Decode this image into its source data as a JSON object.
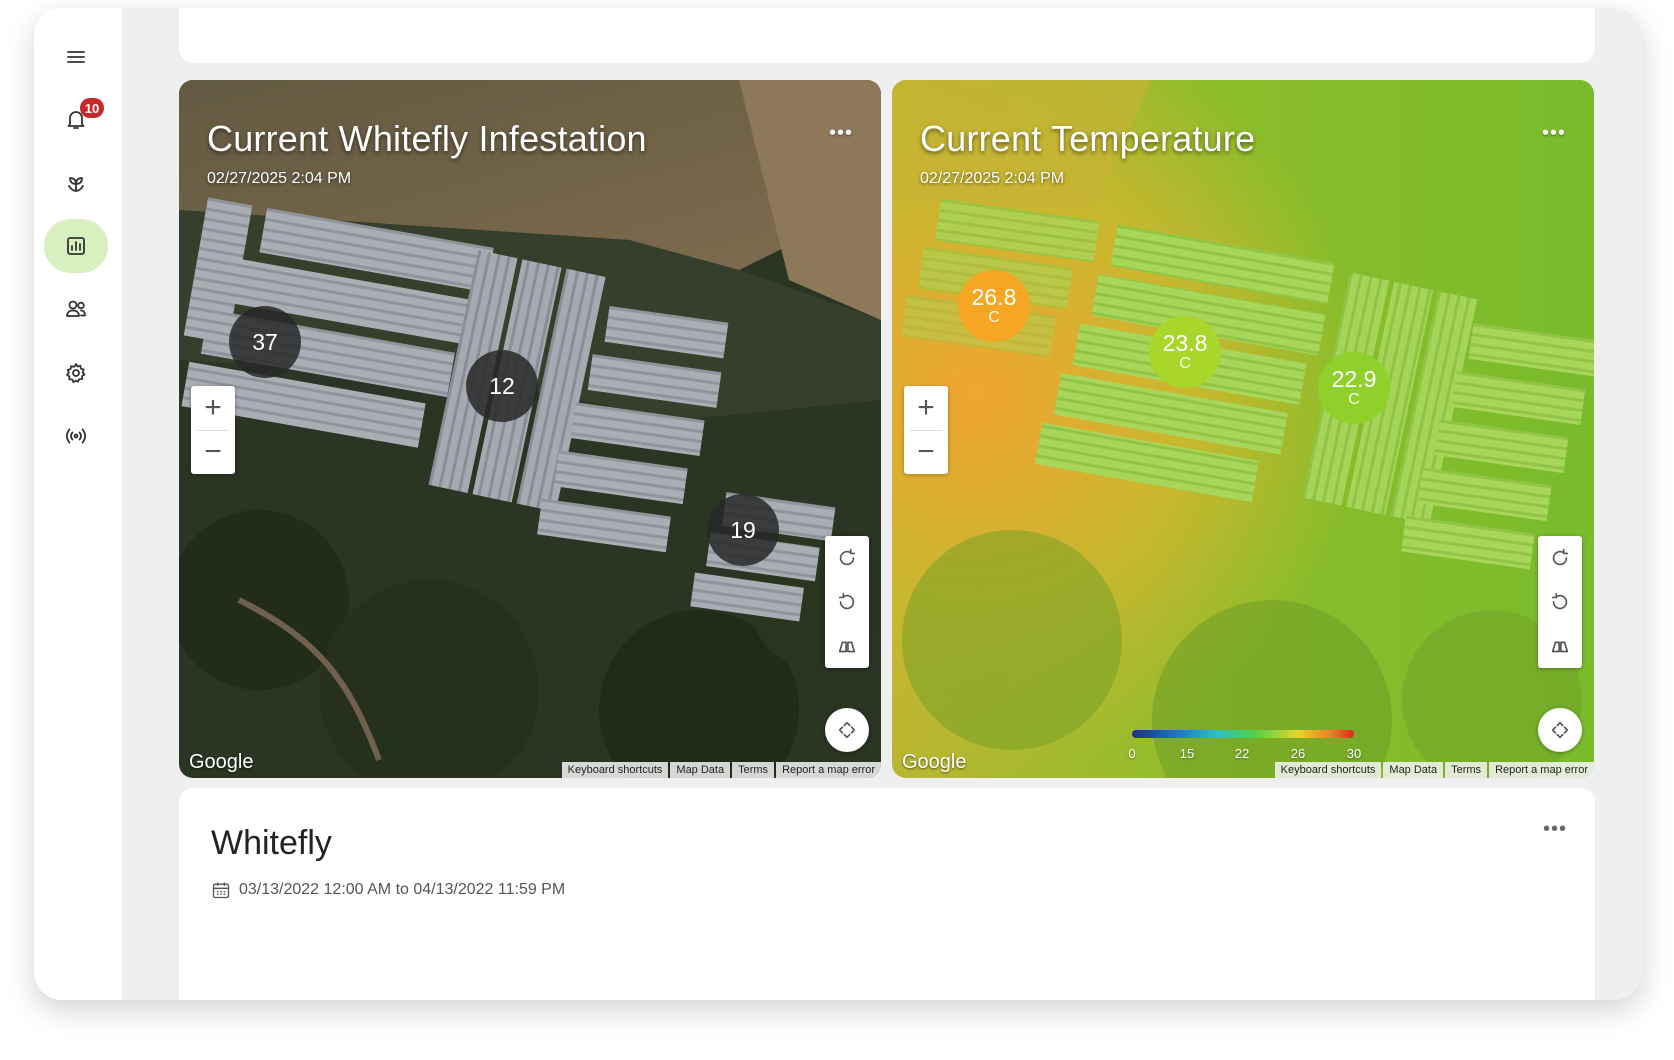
{
  "sidebar": {
    "notification_count": "10"
  },
  "whitefly_map": {
    "title": "Current Whitefly Infestation",
    "timestamp": "02/27/2025 2:04 PM",
    "more_label": "•••",
    "clusters": [
      "37",
      "12",
      "19"
    ]
  },
  "temperature_map": {
    "title": "Current Temperature",
    "timestamp": "02/27/2025 2:04 PM",
    "more_label": "•••",
    "readings": [
      {
        "value": "26.8",
        "unit": "C",
        "color": "#f5a623"
      },
      {
        "value": "23.8",
        "unit": "C",
        "color": "#a9d62b"
      },
      {
        "value": "22.9",
        "unit": "C",
        "color": "#8fd12a"
      }
    ],
    "legend_ticks": [
      "0",
      "15",
      "22",
      "26",
      "30"
    ]
  },
  "map_controls": {
    "zoom_in": "+",
    "zoom_out": "−",
    "google": "Google",
    "attribution": [
      "Keyboard shortcuts",
      "Map Data",
      "Terms",
      "Report a map error"
    ]
  },
  "whitefly_card": {
    "title": "Whitefly",
    "date_range": "03/13/2022 12:00 AM to 04/13/2022 11:59 PM",
    "more_label": "•••"
  },
  "colors": {
    "active_nav": "#d8f0bf",
    "badge": "#c62828"
  }
}
